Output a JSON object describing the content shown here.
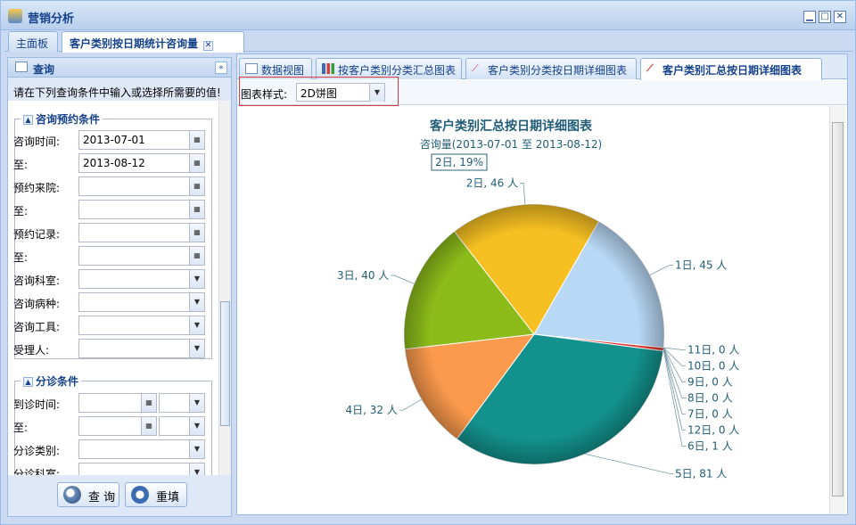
{
  "window": {
    "title": "营销分析"
  },
  "outer_tabs": [
    {
      "label": "主面板"
    },
    {
      "label": "客户类别按日期统计咨询量"
    }
  ],
  "left_panel": {
    "title": "查询",
    "hint": "请在下列查询条件中输入或选择所需要的值!",
    "group1": {
      "legend": "咨询预约条件",
      "rows": [
        {
          "label": "咨询时间:",
          "value": "2013-07-01"
        },
        {
          "label": "至:",
          "value": "2013-08-12"
        },
        {
          "label": "预约来院:",
          "value": ""
        },
        {
          "label": "至:",
          "value": ""
        },
        {
          "label": "预约记录:",
          "value": ""
        },
        {
          "label": "至:",
          "value": ""
        },
        {
          "label": "咨询科室:",
          "value": ""
        },
        {
          "label": "咨询病种:",
          "value": ""
        },
        {
          "label": "咨询工具:",
          "value": ""
        },
        {
          "label": "受理人:",
          "value": ""
        }
      ]
    },
    "group2": {
      "legend": "分诊条件",
      "rows": [
        {
          "label": "到诊时间:",
          "value": ""
        },
        {
          "label": "至:",
          "value": ""
        },
        {
          "label": "分诊类别:",
          "value": ""
        },
        {
          "label": "分诊科室:",
          "value": ""
        }
      ]
    },
    "buttons": {
      "query": "查 询",
      "reset": "重填"
    }
  },
  "inner_tabs": [
    {
      "label": "数据视图"
    },
    {
      "label": "按客户类别分类汇总图表"
    },
    {
      "label": "客户类别分类按日期详细图表"
    },
    {
      "label": "客户类别汇总按日期详细图表"
    }
  ],
  "toolbar": {
    "style_label": "图表样式:",
    "style_value": "2D饼图"
  },
  "chart_data": {
    "type": "pie",
    "title": "客户类别汇总按日期详细图表",
    "subtitle": "咨询量(2013-07-01 至 2013-08-12)",
    "highlight_label": "2日, 19%",
    "slices": [
      {
        "label": "1日",
        "value": 45,
        "text": "1日, 45 人",
        "color": "#b8d8f5"
      },
      {
        "label": "11日",
        "value": 0,
        "text": "11日, 0 人",
        "color": "#cccccc"
      },
      {
        "label": "10日",
        "value": 0,
        "text": "10日, 0 人",
        "color": "#cccccc"
      },
      {
        "label": "9日",
        "value": 0,
        "text": "9日, 0 人",
        "color": "#cccccc"
      },
      {
        "label": "8日",
        "value": 0,
        "text": "8日, 0 人",
        "color": "#cccccc"
      },
      {
        "label": "7日",
        "value": 0,
        "text": "7日, 0 人",
        "color": "#cccccc"
      },
      {
        "label": "12日",
        "value": 0,
        "text": "12日, 0 人",
        "color": "#cccccc"
      },
      {
        "label": "6日",
        "value": 1,
        "text": "6日, 1 人",
        "color": "#e03a30"
      },
      {
        "label": "5日",
        "value": 81,
        "text": "5日, 81 人",
        "color": "#13928d"
      },
      {
        "label": "4日",
        "value": 32,
        "text": "4日, 32 人",
        "color": "#fb9a4c"
      },
      {
        "label": "3日",
        "value": 40,
        "text": "3日, 40 人",
        "color": "#8cbc1a"
      },
      {
        "label": "2日",
        "value": 46,
        "text": "2日, 46 人",
        "color": "#f6c022"
      }
    ]
  }
}
